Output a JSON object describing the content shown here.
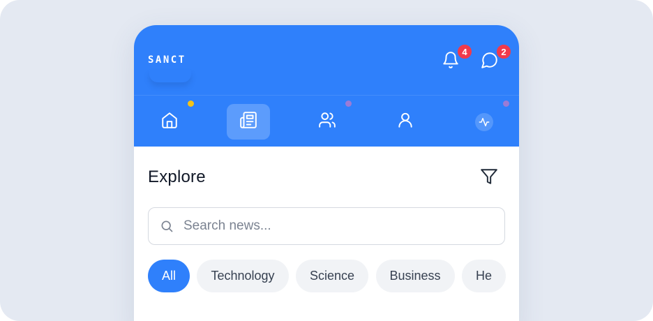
{
  "app": {
    "logo": "SANCT"
  },
  "header": {
    "notifications": {
      "icon": "bell-icon",
      "count": "4"
    },
    "messages": {
      "icon": "message-circle-icon",
      "count": "2"
    }
  },
  "nav": {
    "items": [
      {
        "name": "home",
        "icon": "home-icon",
        "active": false,
        "dot_color": "#f2c318"
      },
      {
        "name": "news",
        "icon": "newspaper-icon",
        "active": true
      },
      {
        "name": "community",
        "icon": "users-icon",
        "active": false,
        "dot_color": "#9b7bd6"
      },
      {
        "name": "profile",
        "icon": "user-icon",
        "active": false
      },
      {
        "name": "activity",
        "icon": "activity-pulse-icon",
        "active": false,
        "dot_color": "#9b7bd6"
      }
    ]
  },
  "main": {
    "title": "Explore",
    "filter_icon": "filter-icon",
    "search": {
      "placeholder": "Search news...",
      "value": "",
      "icon": "search-icon"
    },
    "categories": [
      "All",
      "Technology",
      "Science",
      "Business",
      "He"
    ],
    "selected_category": "All"
  },
  "colors": {
    "primary": "#2f80fb",
    "badge": "#f03a4c",
    "background": "#e4e9f2",
    "chip_bg": "#f1f3f6",
    "text": "#111827"
  }
}
